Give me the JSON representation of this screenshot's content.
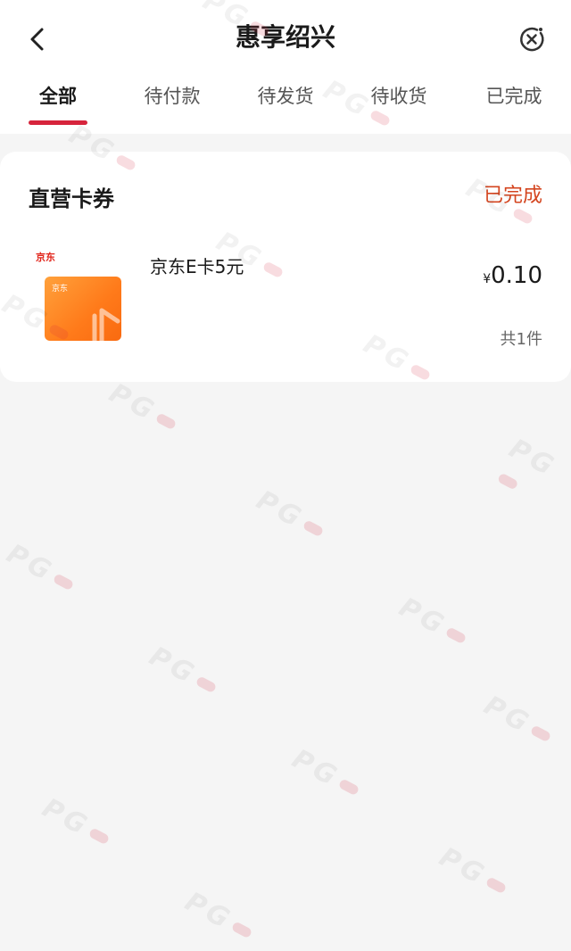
{
  "header": {
    "title": "惠享绍兴",
    "back_icon": "chevron-left-icon",
    "close_icon": "close-circle-icon"
  },
  "tabs": [
    {
      "label": "全部",
      "active": true
    },
    {
      "label": "待付款",
      "active": false
    },
    {
      "label": "待发货",
      "active": false
    },
    {
      "label": "待收货",
      "active": false
    },
    {
      "label": "已完成",
      "active": false
    }
  ],
  "order": {
    "shop": "直营卡券",
    "status": "已完成",
    "item": {
      "brand": "京东",
      "name": "京东E卡5元",
      "currency": "¥",
      "price": "0.10",
      "quantity": "共1件"
    }
  },
  "colors": {
    "accent": "#d6243c",
    "status": "#d4451f",
    "background": "#f5f5f5",
    "card": "#ffffff",
    "gift_card": "#ff7a1a"
  },
  "watermark": "PG"
}
